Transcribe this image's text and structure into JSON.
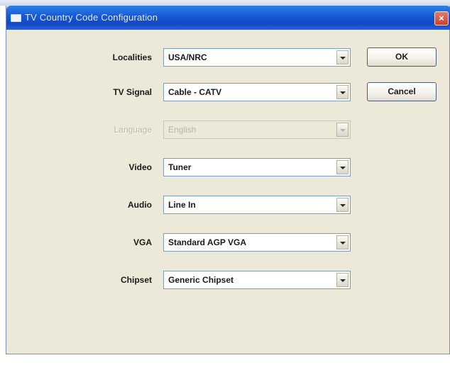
{
  "window": {
    "title": "TV Country Code Configuration",
    "close_glyph": "×"
  },
  "fields": [
    {
      "label": "Localities",
      "value": "USA/NRC",
      "enabled": true
    },
    {
      "label": "TV Signal",
      "value": "Cable - CATV",
      "enabled": true
    },
    {
      "label": "Language",
      "value": "English",
      "enabled": false
    },
    {
      "label": "Video",
      "value": "Tuner",
      "enabled": true
    },
    {
      "label": "Audio",
      "value": "Line In",
      "enabled": true
    },
    {
      "label": "VGA",
      "value": "Standard AGP VGA",
      "enabled": true
    },
    {
      "label": "Chipset",
      "value": "Generic Chipset",
      "enabled": true
    }
  ],
  "buttons": {
    "ok_label": "OK",
    "cancel_label": "Cancel"
  },
  "colors": {
    "titlebar": "#1658d6",
    "dialog_background": "#ece9d8",
    "close_button": "#c9442f"
  },
  "icons": {
    "title_icon": "window-icon",
    "close_icon": "close-icon",
    "dropdown_icon": "chevron-down-icon"
  }
}
